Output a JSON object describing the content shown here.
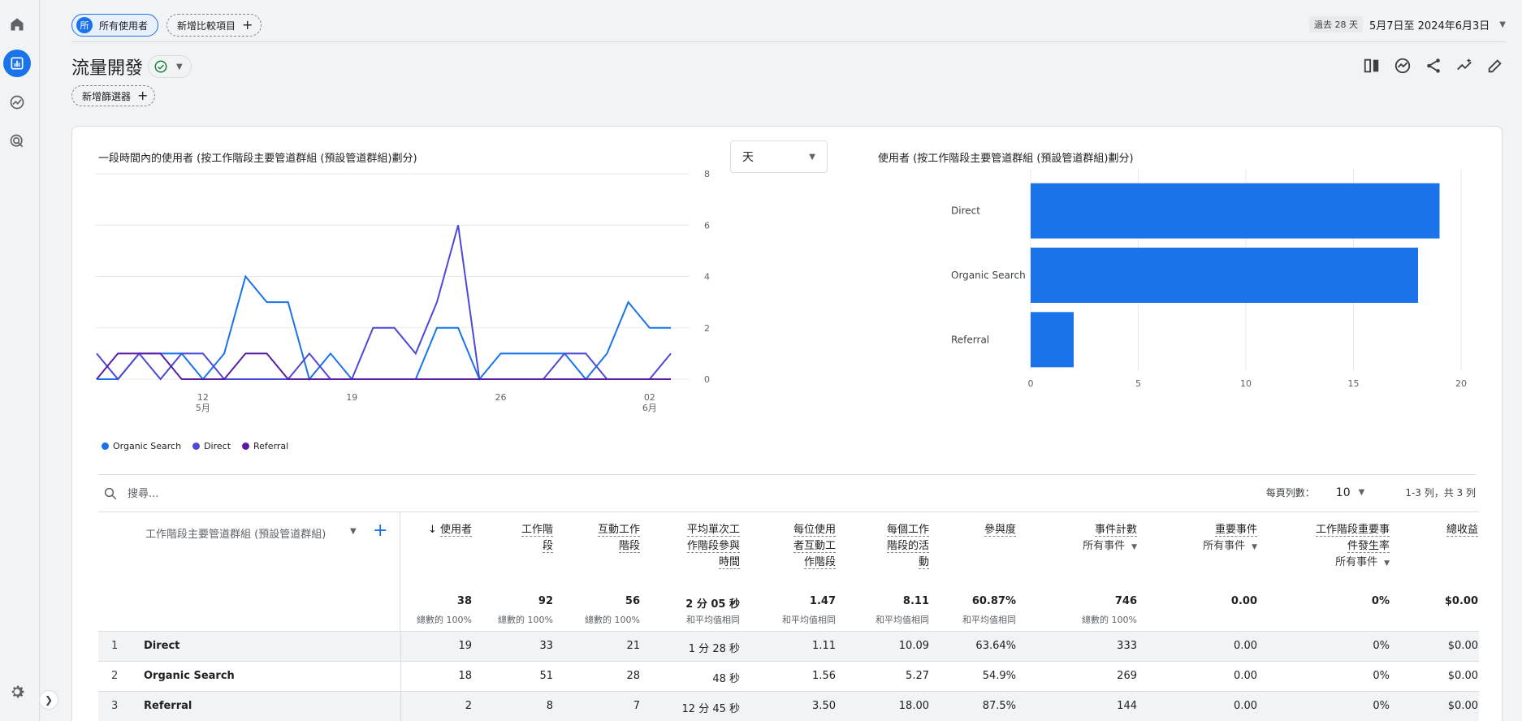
{
  "header": {
    "segment_chip": "所有使用者",
    "segment_avatar": "所",
    "add_comparison": "新增比較項目",
    "date_past": "過去 28 天",
    "date_range": "5月7日至 2024年6月3日",
    "page_title": "流量開發",
    "add_filter": "新增篩選器"
  },
  "line_chart": {
    "title": "一段時間內的使用者 (按工作階段主要管道群組 (預設管道群組)劃分)",
    "granularity": "天",
    "legend": [
      "Organic Search",
      "Direct",
      "Referral"
    ]
  },
  "bar_chart": {
    "title": "使用者 (按工作階段主要管道群組 (預設管道群組)劃分)"
  },
  "chart_data": [
    {
      "type": "line",
      "title": "一段時間內的使用者 (按工作階段主要管道群組 (預設管道群組)劃分)",
      "x": [
        "5/7",
        "5/8",
        "5/9",
        "5/10",
        "5/11",
        "5/12",
        "5/13",
        "5/14",
        "5/15",
        "5/16",
        "5/17",
        "5/18",
        "5/19",
        "5/20",
        "5/21",
        "5/22",
        "5/23",
        "5/24",
        "5/25",
        "5/26",
        "5/27",
        "5/28",
        "5/29",
        "5/30",
        "5/31",
        "6/1",
        "6/2",
        "6/3"
      ],
      "x_ticks": [
        {
          "label": "12",
          "sub": "5月"
        },
        {
          "label": "19"
        },
        {
          "label": "26"
        },
        {
          "label": "02",
          "sub": "6月"
        }
      ],
      "ylim": [
        0,
        8
      ],
      "y_ticks": [
        0,
        2,
        4,
        6,
        8
      ],
      "series": [
        {
          "name": "Organic Search",
          "color": "#1a73e8",
          "values": [
            0,
            0,
            1,
            1,
            1,
            0,
            1,
            4,
            3,
            3,
            0,
            1,
            0,
            0,
            0,
            0,
            2,
            2,
            0,
            1,
            1,
            1,
            1,
            0,
            1,
            3,
            2,
            2
          ]
        },
        {
          "name": "Direct",
          "color": "#4b49d6",
          "values": [
            1,
            0,
            1,
            0,
            1,
            1,
            0,
            0,
            0,
            0,
            1,
            0,
            0,
            2,
            2,
            1,
            3,
            6,
            0,
            0,
            0,
            0,
            1,
            1,
            0,
            0,
            0,
            1
          ]
        },
        {
          "name": "Referral",
          "color": "#5b1da3",
          "values": [
            0,
            1,
            1,
            1,
            0,
            0,
            0,
            1,
            1,
            0,
            0,
            0,
            0,
            0,
            0,
            0,
            0,
            0,
            0,
            0,
            0,
            0,
            0,
            0,
            0,
            0,
            0,
            0
          ]
        }
      ],
      "grid": true,
      "legend_position": "bottom-left"
    },
    {
      "type": "bar",
      "orientation": "horizontal",
      "title": "使用者 (按工作階段主要管道群組 (預設管道群組)劃分)",
      "categories": [
        "Direct",
        "Organic Search",
        "Referral"
      ],
      "values": [
        19,
        18,
        2
      ],
      "xlim": [
        0,
        20
      ],
      "x_ticks": [
        0,
        5,
        10,
        15,
        20
      ],
      "color": "#1a73e8",
      "grid": true
    }
  ],
  "table": {
    "search_placeholder": "搜尋...",
    "rows_per_page_label": "每頁列數：",
    "rows_per_page": "10",
    "pagination": "1-3 列，共 3 列",
    "dimension_header": "工作階段主要管道群組 (預設管道群組)",
    "columns": [
      {
        "lines": [
          "使用者"
        ],
        "arrow": "↓",
        "total": "38",
        "total_sub": "總數的 100%"
      },
      {
        "lines": [
          "工作階",
          "段"
        ],
        "total": "92",
        "total_sub": "總數的 100%"
      },
      {
        "lines": [
          "互動工作",
          "階段"
        ],
        "total": "56",
        "total_sub": "總數的 100%"
      },
      {
        "lines": [
          "平均單次工",
          "作階段參與",
          "時間"
        ],
        "total": "2 分 05 秒",
        "total_sub": "和平均值相同"
      },
      {
        "lines": [
          "每位使用",
          "者互動工",
          "作階段"
        ],
        "total": "1.47",
        "total_sub": "和平均值相同"
      },
      {
        "lines": [
          "每個工作",
          "階段的活",
          "動"
        ],
        "total": "8.11",
        "total_sub": "和平均值相同"
      },
      {
        "lines": [
          "參與度"
        ],
        "total": "60.87%",
        "total_sub": "和平均值相同"
      },
      {
        "lines": [
          "事件計數"
        ],
        "filter": "所有事件",
        "total": "746",
        "total_sub": "總數的 100%"
      },
      {
        "lines": [
          "重要事件"
        ],
        "filter": "所有事件",
        "total": "0.00",
        "total_sub": ""
      },
      {
        "lines": [
          "工作階段重要事",
          "件發生率"
        ],
        "filter": "所有事件",
        "total": "0%",
        "total_sub": ""
      },
      {
        "lines": [
          "總收益"
        ],
        "total": "$0.00",
        "total_sub": ""
      }
    ],
    "rows": [
      {
        "idx": "1",
        "name": "Direct",
        "vals": [
          "19",
          "33",
          "21",
          "1 分 28 秒",
          "1.11",
          "10.09",
          "63.64%",
          "333",
          "0.00",
          "0%",
          "$0.00"
        ]
      },
      {
        "idx": "2",
        "name": "Organic Search",
        "vals": [
          "18",
          "51",
          "28",
          "48 秒",
          "1.56",
          "5.27",
          "54.9%",
          "269",
          "0.00",
          "0%",
          "$0.00"
        ]
      },
      {
        "idx": "3",
        "name": "Referral",
        "vals": [
          "2",
          "8",
          "7",
          "12 分 45 秒",
          "3.50",
          "18.00",
          "87.5%",
          "144",
          "0.00",
          "0%",
          "$0.00"
        ]
      }
    ]
  }
}
